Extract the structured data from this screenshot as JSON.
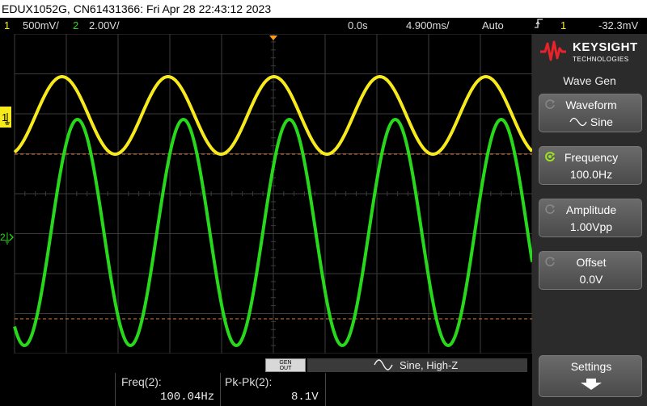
{
  "title_bar": {
    "text": "EDUX1052G, CN61431366: Fri Apr 28 22:43:12 2023"
  },
  "status_bar": {
    "ch1_num": "1",
    "ch1_scale": "500mV/",
    "ch2_num": "2",
    "ch2_scale": "2.00V/",
    "time_delay": "0.0s",
    "time_scale": "4.900ms/",
    "trigger_mode": "Auto",
    "trigger_source": "1",
    "trigger_level": "-32.3mV"
  },
  "screen": {
    "ch1_marker": "1",
    "ch2_marker": "2",
    "colors": {
      "ch1": "#f7ea1c",
      "ch2": "#27d81b",
      "grid": "#3c3c3c",
      "ref": "#e07b3a",
      "trigger": "#ff9a1a"
    }
  },
  "bottom_bar": {
    "gen_out_line1": "GEN",
    "gen_out_line2": "OUT",
    "wave_icon": "sine-wave-icon",
    "gen_info": "Sine, High-Z"
  },
  "measurements": [
    {
      "label": "Freq(2):",
      "value": "100.04Hz"
    },
    {
      "label": "Pk-Pk(2):",
      "value": "8.1V"
    }
  ],
  "right_panel": {
    "brand": "KEYSIGHT",
    "brand_sub": "TECHNOLOGIES",
    "title": "Wave Gen",
    "softkeys": [
      {
        "label": "Waveform",
        "value": "Sine",
        "active": false
      },
      {
        "label": "Frequency",
        "value": "100.0Hz",
        "active": true
      },
      {
        "label": "Amplitude",
        "value": "1.00Vpp",
        "active": false
      },
      {
        "label": "Offset",
        "value": "0.0V",
        "active": false
      }
    ],
    "settings_label": "Settings"
  }
}
